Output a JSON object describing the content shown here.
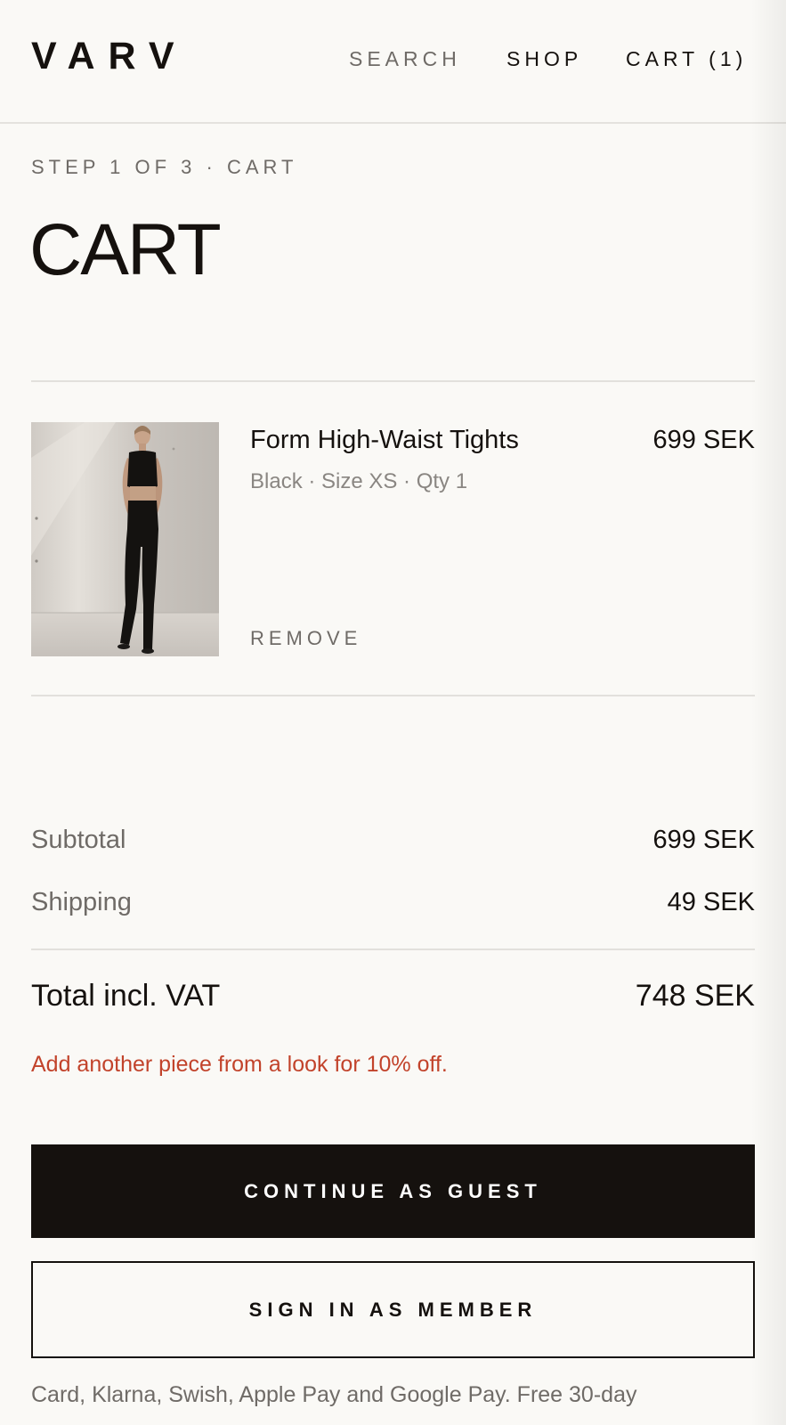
{
  "header": {
    "logo": "VARV",
    "nav": {
      "search": "SEARCH",
      "shop": "SHOP",
      "cart": "CART (1)"
    }
  },
  "step": "STEP 1 OF 3 · CART",
  "page_title": "CART",
  "cart_item": {
    "name": "Form High-Waist Tights",
    "price": "699 SEK",
    "meta": "Black · Size XS · Qty 1",
    "remove_label": "REMOVE",
    "image": "product-photo-black-tights"
  },
  "summary": {
    "subtotal_label": "Subtotal",
    "subtotal_value": "699 SEK",
    "shipping_label": "Shipping",
    "shipping_value": "49 SEK",
    "total_label": "Total incl. VAT",
    "total_value": "748 SEK"
  },
  "promo": {
    "text": "Add another piece from a look for 10% off.",
    "color": "#c2432b"
  },
  "actions": {
    "guest_label": "CONTINUE AS GUEST",
    "member_label": "SIGN IN AS MEMBER"
  },
  "payment_note": "Card, Klarna, Swish, Apple Pay and Google Pay. Free 30-day"
}
